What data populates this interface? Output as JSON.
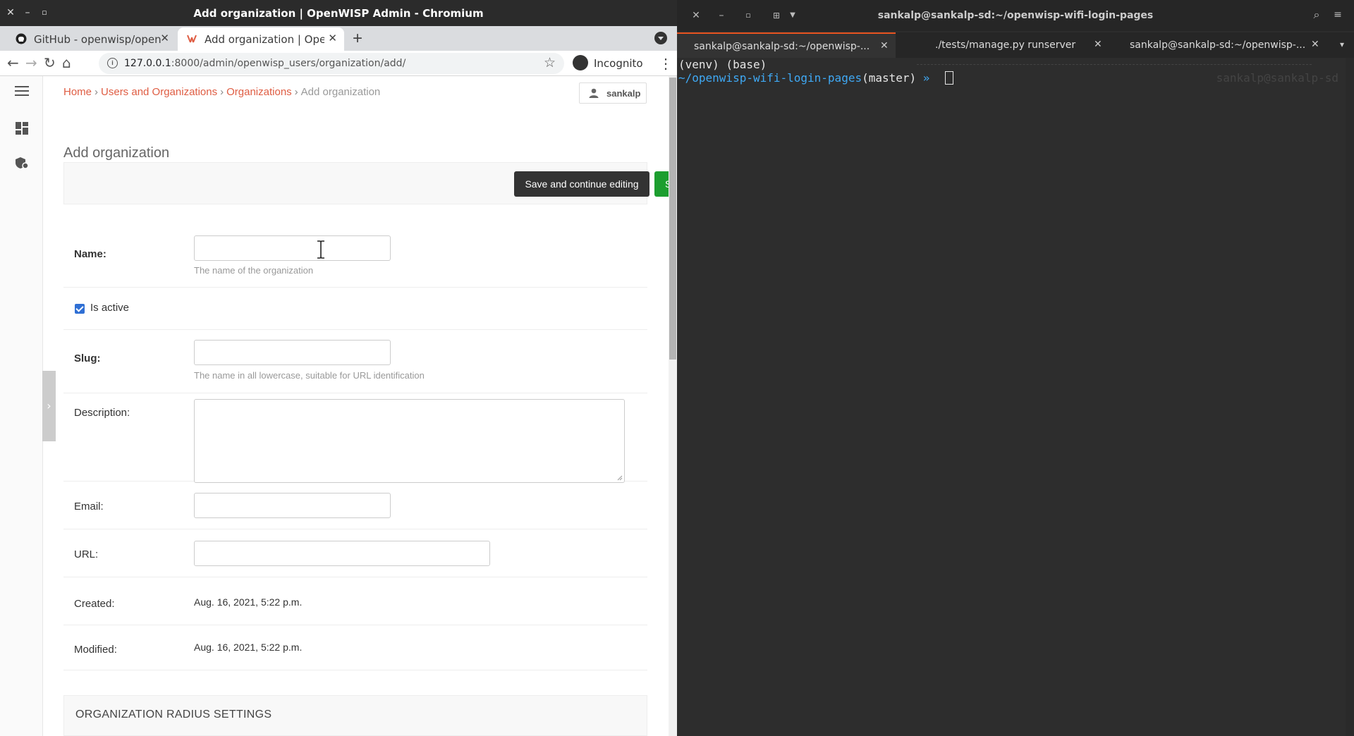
{
  "browser": {
    "window_title": "Add organization | OpenWISP Admin - Chromium",
    "tabs": [
      {
        "label": "GitHub - openwisp/openw",
        "icon": "github-icon"
      },
      {
        "label": "Add organization | OpenW",
        "icon": "openwisp-icon"
      }
    ],
    "url_host": "127.0.0.1",
    "url_rest": ":8000/admin/openwisp_users/organization/add/",
    "incognito_label": "Incognito"
  },
  "admin": {
    "breadcrumb": {
      "home": "Home",
      "users_orgs": "Users and Organizations",
      "organizations": "Organizations",
      "current": "Add organization"
    },
    "user": "sankalp",
    "title": "Add organization",
    "buttons": {
      "save_continue": "Save and continue editing",
      "save": "SAVE"
    },
    "fields": {
      "name_label": "Name:",
      "name_help": "The name of the organization",
      "is_active_label": "Is active",
      "is_active_checked": true,
      "slug_label": "Slug:",
      "slug_help": "The name in all lowercase, suitable for URL identification",
      "description_label": "Description:",
      "email_label": "Email:",
      "url_label": "URL:",
      "created_label": "Created:",
      "created_value": "Aug. 16, 2021, 5:22 p.m.",
      "modified_label": "Modified:",
      "modified_value": "Aug. 16, 2021, 5:22 p.m."
    },
    "radius_section": "ORGANIZATION RADIUS SETTINGS"
  },
  "terminal": {
    "window_title": "sankalp@sankalp-sd:~/openwisp-wifi-login-pages",
    "tabs": [
      {
        "label": "sankalp@sankalp-sd:~/openwisp-..."
      },
      {
        "label": "./tests/manage.py runserver"
      },
      {
        "label": "sankalp@sankalp-sd:~/openwisp-..."
      }
    ],
    "line1": "(venv) (base)",
    "prompt_path": "~/openwisp-wifi-login-pages",
    "prompt_branch": "(master)",
    "prompt_arrow": "»",
    "right_prompt": "sankalp@sankalp-sd"
  },
  "colors": {
    "link": "#df5d43",
    "save_button": "#1c9e2f",
    "continue_button": "#333333",
    "terminal_bg": "#2d2d2d",
    "terminal_prompt": "#3fa9f5",
    "checkbox": "#2f6fd4"
  }
}
